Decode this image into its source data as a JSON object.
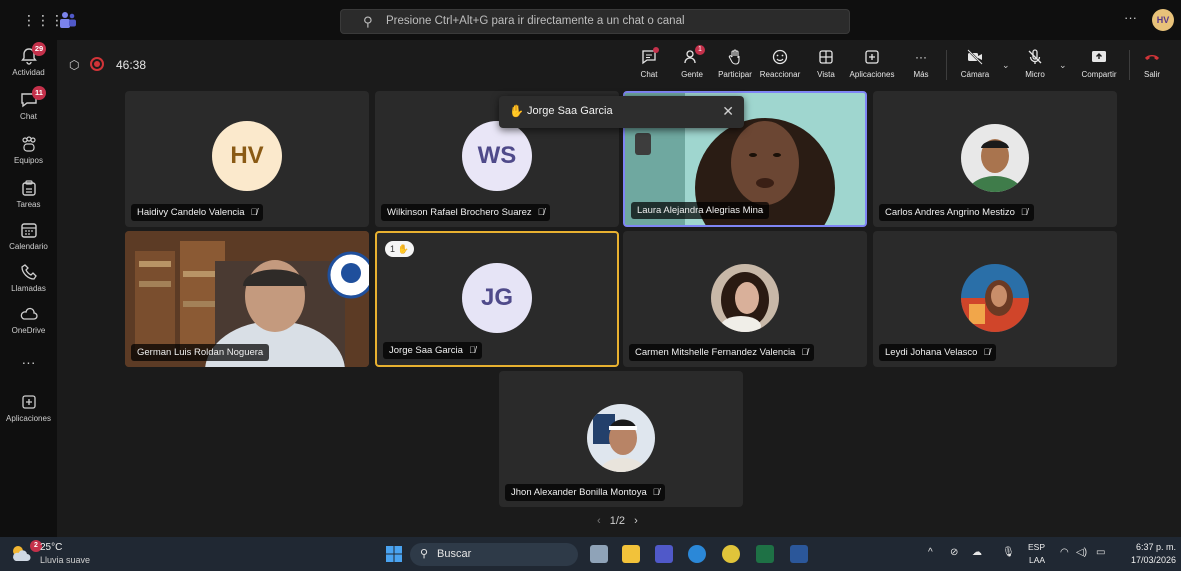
{
  "colors": {
    "accent": "#7f85f5",
    "raise_hand": "#e8b130",
    "leave": "#d13438",
    "badge": "#c4314b"
  },
  "topbar": {
    "search_placeholder": "Presione Ctrl+Alt+G para ir directamente a un chat o canal",
    "more": "···",
    "user_initials": "HV"
  },
  "rail": {
    "items": [
      {
        "label": "Actividad",
        "icon": "bell-icon",
        "badge": "29"
      },
      {
        "label": "Chat",
        "icon": "chat-icon",
        "badge": "11"
      },
      {
        "label": "Equipos",
        "icon": "teams-icon"
      },
      {
        "label": "Tareas",
        "icon": "tasks-icon"
      },
      {
        "label": "Calendario",
        "icon": "calendar-icon"
      },
      {
        "label": "Llamadas",
        "icon": "phone-icon"
      },
      {
        "label": "OneDrive",
        "icon": "cloud-icon"
      },
      {
        "label": "···",
        "icon": "more-icon"
      },
      {
        "label": "Aplicaciones",
        "icon": "apps-icon"
      }
    ]
  },
  "meeting": {
    "timer": "46:38",
    "toolbar": {
      "chat": "Chat",
      "people": "Gente",
      "people_badge": "1",
      "raise": "Participar",
      "react": "Reaccionar",
      "view": "Vista",
      "apps": "Aplicaciones",
      "more": "Más",
      "camera": "Cámara",
      "mic": "Micro",
      "share": "Compartir",
      "leave": "Salir"
    },
    "toast": {
      "text": "Jorge Saa Garcia"
    },
    "participants": [
      {
        "name": "Haidivy Candelo Valencia",
        "initials": "HV",
        "avatar_bg": "#fbe9cc",
        "avatar_fg": "#8a5a14",
        "kind": "initials"
      },
      {
        "name": "Wilkinson Rafael Brochero Suarez",
        "initials": "WS",
        "avatar_bg": "#e9e6f7",
        "avatar_fg": "#4f4a8a",
        "kind": "initials"
      },
      {
        "name": "Laura Alejandra Alegrias Mina",
        "kind": "video"
      },
      {
        "name": "Carlos Andres Angrino Mestizo",
        "kind": "photo"
      },
      {
        "name": "German Luis Roldan Noguera",
        "kind": "video"
      },
      {
        "name": "Jorge Saa Garcia",
        "initials": "JG",
        "avatar_bg": "#e6e4f6",
        "avatar_fg": "#4f4a8a",
        "kind": "initials",
        "raise_count": "1"
      },
      {
        "name": "Carmen Mitshelle Fernandez Valencia",
        "kind": "photo"
      },
      {
        "name": "Leydi Johana Velasco",
        "kind": "photo"
      },
      {
        "name": "Jhon Alexander Bonilla Montoya",
        "kind": "photo"
      }
    ],
    "pager": "1/2"
  },
  "taskbar": {
    "temp": "25°C",
    "weather": "Lluvia suave",
    "weather_badge": "2",
    "search": "Buscar",
    "lang1": "ESP",
    "lang2": "LAA",
    "time": "6:37 p. m.",
    "date": "17/03/2026"
  }
}
